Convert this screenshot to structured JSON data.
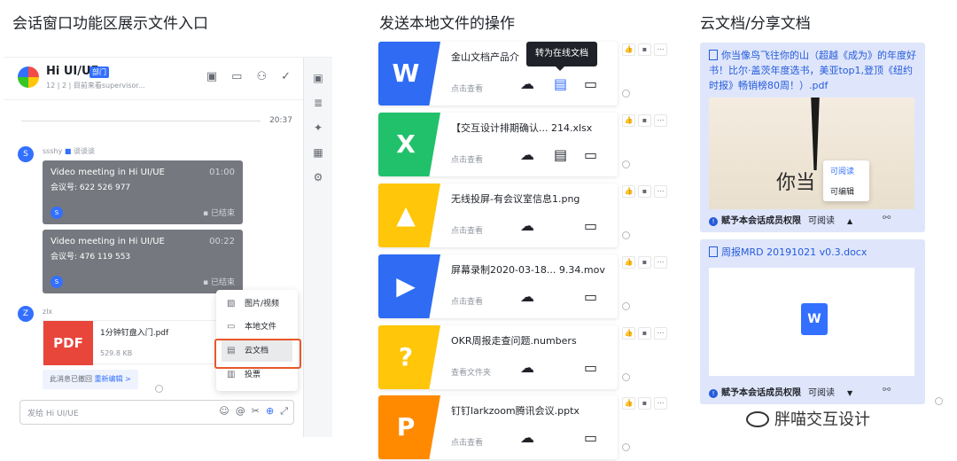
{
  "sections": {
    "chat_title": "会话窗口功能区展示文件入口",
    "local_title": "发送本地文件的操作",
    "cloud_title": "云文档/分享文档"
  },
  "chat": {
    "name": "Hi UI/UE",
    "dept_badge": "部门",
    "meta": "12 | 2 | 目前来看supervisor...",
    "time": "20:37",
    "sender1": "ssshy",
    "sender1_status": "谈谈谈",
    "sender1_initial": "S",
    "meetings": [
      {
        "title": "Video meeting in Hi UI/UE",
        "duration": "01:00",
        "id": "会议号: 622 526 977",
        "status": "已结束",
        "initial": "S"
      },
      {
        "title": "Video meeting in Hi UI/UE",
        "duration": "00:22",
        "id": "会议号: 476 119 553",
        "status": "已结束",
        "initial": "S"
      }
    ],
    "sender2": "zlx",
    "sender2_initial": "Z",
    "pdf": {
      "label": "PDF",
      "name": "1分钟钉盘入门.pdf",
      "size": "529.8 KB"
    },
    "recall_text": "此消息已撤回",
    "recall_edit": "重新编辑 >",
    "input_placeholder": "发给 Hi UI/UE",
    "menu": [
      "图片/视频",
      "本地文件",
      "云文档",
      "投票"
    ]
  },
  "files": [
    {
      "name": "金山文档产品介",
      "sub": "点击查看",
      "letter": "W",
      "color": "#2f6bf3"
    },
    {
      "name": "【交互设计排期确认... 214.xlsx",
      "sub": "点击查看",
      "letter": "X",
      "color": "#21c16b"
    },
    {
      "name": "无线投屏-有会议室信息1.png",
      "sub": "点击查看",
      "letter": "▲",
      "color": "#ffc60a"
    },
    {
      "name": "屏幕录制2020-03-18... 9.34.mov",
      "sub": "点击查看",
      "letter": "▶",
      "color": "#2f6bf3"
    },
    {
      "name": "OKR周报走查问题.numbers",
      "sub": "查看文件夹",
      "letter": "?",
      "color": "#ffc60a"
    },
    {
      "name": "钉钉larkzoom腾讯会议.pptx",
      "sub": "点击查看",
      "letter": "P",
      "color": "#ff8a00"
    }
  ],
  "tooltip": "转为在线文档",
  "cloud": {
    "doc1_title": "你当像鸟飞往你的山（超越《成为》的年度好书！比尔·盖茨年度选书，美亚top1,登顶《纽约时报》畅销榜80周！）.pdf",
    "doc1_preview": "你当",
    "doc2_title": "周报MRD 20191021 v0.3.docx",
    "doc2_icon": "W",
    "perm_label": "赋予本会话成员权限",
    "perm_value": "可阅读",
    "perm_options": [
      "可阅读",
      "可编辑"
    ]
  },
  "watermark": "胖喵交互设计"
}
